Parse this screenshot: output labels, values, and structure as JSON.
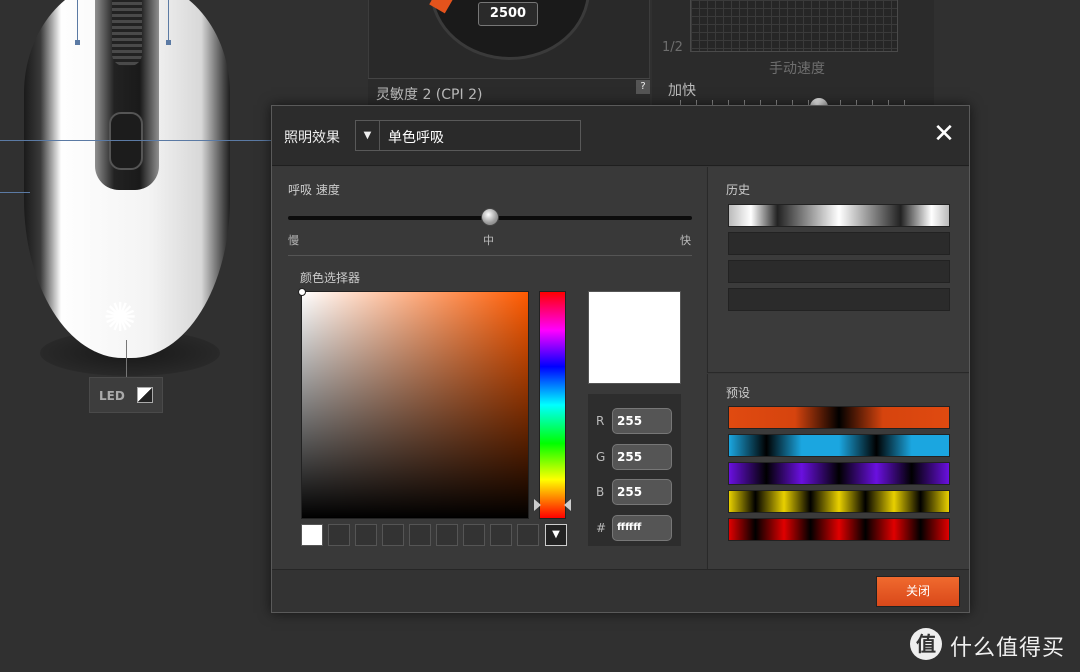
{
  "background": {
    "dial_value": "2500",
    "cpi_label": "灵敏度 2 (CPI 2)",
    "help_icon": "?",
    "ratio": "1/2",
    "manual_speed": "手动速度",
    "acceleration": "加快",
    "led_label": "LED"
  },
  "dialog": {
    "effect_label": "照明效果",
    "effect_value": "单色呼吸",
    "effect_arrow": "▼",
    "close_icon": "✕",
    "breath_speed_label": "呼吸 速度",
    "speed_ticks": [
      "慢",
      "中",
      "快"
    ],
    "speed_value": 0.5,
    "color_picker_title": "颜色选择器",
    "rgb": {
      "r_label": "R",
      "r": "255",
      "g_label": "G",
      "g": "255",
      "b_label": "B",
      "b": "255",
      "hex_label": "#",
      "hex": "ffffff"
    },
    "selected_color": "#ffffff",
    "history_title": "历史",
    "preset_title": "预设",
    "close_button": "关闭",
    "swatch_dropdown": "▼"
  },
  "accent_color": "#e4531c",
  "watermark": {
    "logo_char": "值",
    "text": "什么值得买"
  }
}
